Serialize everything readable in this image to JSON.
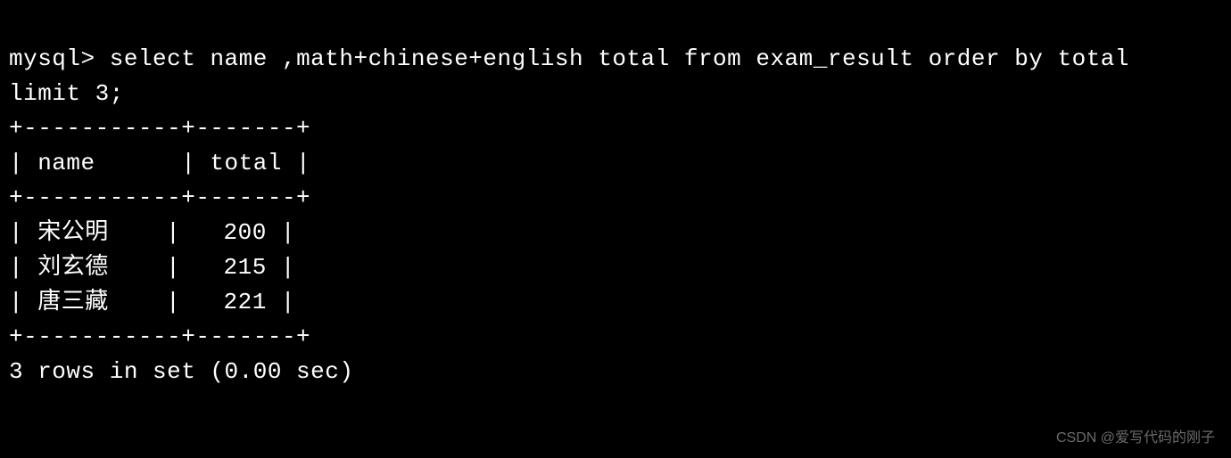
{
  "terminal": {
    "prompt": "mysql>",
    "query": "select name ,math+chinese+english total from exam_result order by total  limit 3;",
    "table": {
      "border_top": "+-----------+-------+",
      "header_row": "| name      | total |",
      "border_mid": "+-----------+-------+",
      "rows": [
        "| 宋公明    |   200 |",
        "| 刘玄德    |   215 |",
        "| 唐三藏    |   221 |"
      ],
      "border_bottom": "+-----------+-------+"
    },
    "result_summary": "3 rows in set (0.00 sec)"
  },
  "chart_data": {
    "type": "table",
    "columns": [
      "name",
      "total"
    ],
    "rows": [
      {
        "name": "宋公明",
        "total": 200
      },
      {
        "name": "刘玄德",
        "total": 215
      },
      {
        "name": "唐三藏",
        "total": 221
      }
    ]
  },
  "watermark": "CSDN @爱写代码的刚子"
}
